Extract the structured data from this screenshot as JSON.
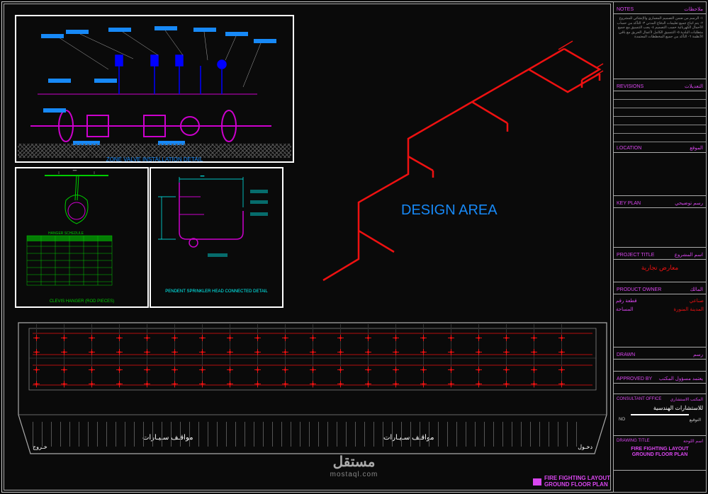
{
  "drawing": {
    "main_title_1": "FIRE FIGHTING LAYOUT",
    "main_title_2": "GROUND FLOOR PLAN",
    "design_area": "DESIGN AREA"
  },
  "details": {
    "zone_valve": "ZONE VALVE INSTALLATION DETAIL",
    "pendant": "PENDENT SPRINKLER HEAD CONNECTED DETAIL",
    "hanger": "CLEVIS HANGER (ROD PIECES)"
  },
  "floorplan": {
    "parking_ar_1": "مواقـف سـيـارات",
    "parking_ar_2": "مواقـف سـيـارات",
    "entry": "دخـول",
    "exit": "خـروج"
  },
  "titleblock": {
    "notes_label": "NOTES",
    "notes_label_ar": "ملاحظات",
    "revisions_label": "REVISIONS",
    "revisions_label_ar": "التعديلات",
    "location_label": "LOCATION",
    "location_label_ar": "الموقع",
    "key_plan_label": "KEY PLAN",
    "key_plan_label_ar": "رسم توضيحي",
    "project_title_label": "PROJECT TITLE",
    "project_title_label_ar": "اسم المشروع",
    "project_name": "معارض تجارية",
    "owner_label": "PRODUCT OWNER",
    "owner_label_ar": "المالك",
    "owner_plot": "قطعة رقم",
    "owner_plot_val": "صناعي",
    "owner_area": "المساحة",
    "owner_area_val": "المدينة المنورة",
    "drawn_label": "DRAWN",
    "drawn_label_ar": "رسم",
    "approved_label": "APPROVED BY",
    "approved_label_ar": "يعتمد مسؤول المكتب",
    "consultant_label": "CONSULTANT OFFICE",
    "consultant_label_ar": "المكتب الاستشاري",
    "consultant_name": "للاستشارات الهندسية",
    "sig_name": "التوقيع",
    "sig_date": "NO",
    "drawing_title_label": "DRAWING TITLE",
    "drawing_title_label_ar": "اسم اللوحة",
    "notes_text": "١- الرسم من ضمن التصميم المعماري والإنشائي للمشروع\n٢- يتم اتباع جميع تعليمات الدفاع المدني\n٣- التأكد من حساب الأحمال الكهربائية حسب التصميم\n٤- يجب التنسيق مع جميع متطلبات البلدية\n٥- التنسيق الكامل لأعمال الحريق مع باقي الأنظمة\n٦- التأكد من جميع المخططات المعتمدة"
  },
  "watermark": {
    "text": "مستقل",
    "url": "mostaql.com"
  },
  "legend": {
    "text": "FIRE FIGHTING LAYOUT GROUND FLOOR PLAN"
  }
}
